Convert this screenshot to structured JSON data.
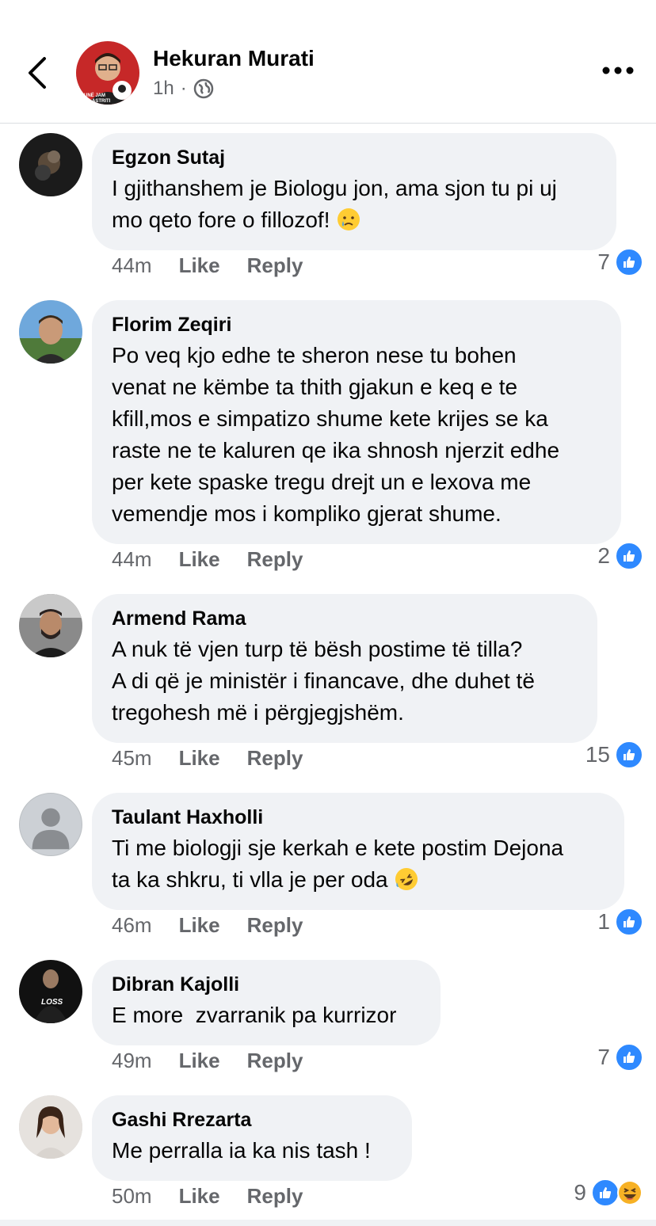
{
  "header": {
    "name": "Hekuran Murati",
    "time": "1h",
    "separator": "·",
    "avatar_caption": "UNË JAM ASTRITI"
  },
  "comments": [
    {
      "author": "Egzon Sutaj",
      "text": "I gjithanshem je Biologu jon, ama sjon tu pi uj\nmo qeto fore o fillozof! ",
      "emoji": "crying-face",
      "time": "44m",
      "like_label": "Like",
      "reply_label": "Reply",
      "reaction_count": "7"
    },
    {
      "author": "Florim Zeqiri",
      "text": "Po veq kjo edhe te sheron nese tu bohen\nvenat ne këmbe ta thith gjakun e keq e te\nkfill,mos e simpatizo shume kete krijes se ka\nraste ne te kaluren qe ika shnosh njerzit edhe\nper kete spaske tregu drejt un e lexova me\nvemendje mos i kompliko gjerat shume.",
      "time": "44m",
      "like_label": "Like",
      "reply_label": "Reply",
      "reaction_count": "2"
    },
    {
      "author": "Armend Rama",
      "text": "A nuk të vjen turp të bësh postime të tilla?\nA di që je ministër i financave, dhe duhet të\ntregohesh më i përgjegjshëm.",
      "time": "45m",
      "like_label": "Like",
      "reply_label": "Reply",
      "reaction_count": "15"
    },
    {
      "author": "Taulant Haxholli",
      "text": "Ti me biologji sje kerkah e kete postim Dejona\nta ka shkru, ti vlla je per oda ",
      "emoji": "rolling-laughing-face",
      "time": "46m",
      "like_label": "Like",
      "reply_label": "Reply",
      "reaction_count": "1"
    },
    {
      "author": "Dibran Kajolli",
      "text": "E more  zvarranik pa kurrizor",
      "time": "49m",
      "like_label": "Like",
      "reply_label": "Reply",
      "reaction_count": "7",
      "avatar_text": "LOSS"
    },
    {
      "author": "Gashi Rrezarta",
      "text": "Me perralla ia ka nis tash !",
      "time": "50m",
      "like_label": "Like",
      "reply_label": "Reply",
      "reaction_count": "9"
    }
  ],
  "colors": {
    "accent": "#2e89ff",
    "bubble": "#f0f2f5",
    "meta": "#65676b"
  }
}
